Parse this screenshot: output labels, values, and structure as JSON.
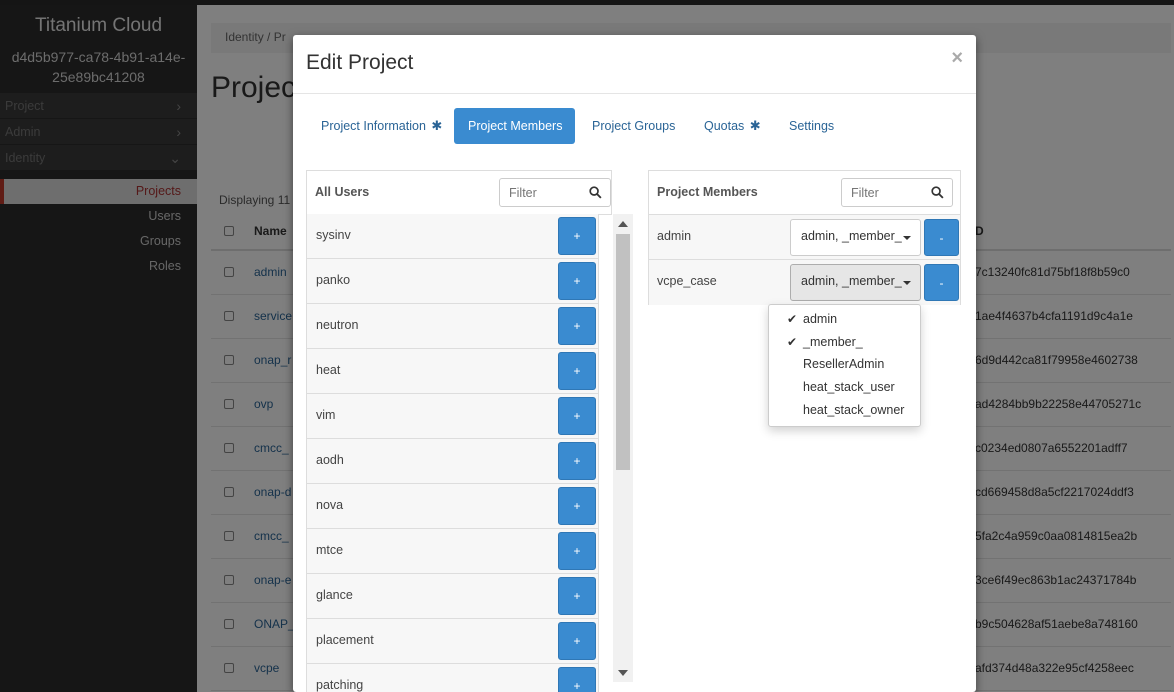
{
  "sidebar": {
    "brand": "Titanium Cloud",
    "project_id": "d4d5b977-ca78-4b91-a14e-25e89bc41208",
    "nav": [
      {
        "label": "Project"
      },
      {
        "label": "Admin"
      },
      {
        "label": "Identity"
      }
    ],
    "identity_items": [
      {
        "label": "Projects"
      },
      {
        "label": "Users"
      },
      {
        "label": "Groups"
      },
      {
        "label": "Roles"
      }
    ]
  },
  "page": {
    "breadcrumb": "Identity /  Pr",
    "title": "Projec",
    "displaying": "Displaying 11",
    "col_name": "Name",
    "col_id": "D",
    "rows": [
      {
        "name": "admin",
        "id": "7c13240fc81d75bf18f8b59c0"
      },
      {
        "name": "service",
        "id": "1ae4f4637b4cfa1191d9c4a1e"
      },
      {
        "name": "onap_r",
        "id": "6d9d442ca81f79958e4602738"
      },
      {
        "name": "ovp",
        "id": "ad4284bb9b22258e44705271c"
      },
      {
        "name": "cmcc_",
        "id": "c0234ed0807a6552201adff7"
      },
      {
        "name": "onap-d",
        "id": "cd669458d8a5cf2217024ddf3"
      },
      {
        "name": "cmcc_",
        "id": "5fa2c4a959c0aa0814815ea2b"
      },
      {
        "name": "onap-e",
        "id": "3ce6f49ec863b1ac24371784b"
      },
      {
        "name": "ONAP_",
        "id": "b9c504628af51aebe8a748160"
      },
      {
        "name": "vcpe",
        "id": "afd374d48a322e95cf4258eec"
      }
    ]
  },
  "modal": {
    "title": "Edit Project",
    "close": "×",
    "tabs": [
      {
        "label": "Project Information",
        "required": "✱"
      },
      {
        "label": "Project Members",
        "required": ""
      },
      {
        "label": "Project Groups",
        "required": ""
      },
      {
        "label": "Quotas",
        "required": "✱"
      },
      {
        "label": "Settings",
        "required": ""
      }
    ],
    "all_users": {
      "title": "All Users",
      "filter_placeholder": "Filter",
      "add_label": "+",
      "users": [
        "sysinv",
        "panko",
        "neutron",
        "heat",
        "vim",
        "aodh",
        "nova",
        "mtce",
        "glance",
        "placement",
        "patching"
      ]
    },
    "members": {
      "title": "Project Members",
      "filter_placeholder": "Filter",
      "remove_label": "-",
      "rows": [
        {
          "name": "admin",
          "roles": "admin, _member_"
        },
        {
          "name": "vcpe_case",
          "roles": "admin, _member_"
        }
      ]
    },
    "roles_dropdown": [
      {
        "label": "admin",
        "checked": "✔"
      },
      {
        "label": "_member_",
        "checked": "✔"
      },
      {
        "label": "ResellerAdmin",
        "checked": ""
      },
      {
        "label": "heat_stack_user",
        "checked": ""
      },
      {
        "label": "heat_stack_owner",
        "checked": ""
      }
    ]
  }
}
